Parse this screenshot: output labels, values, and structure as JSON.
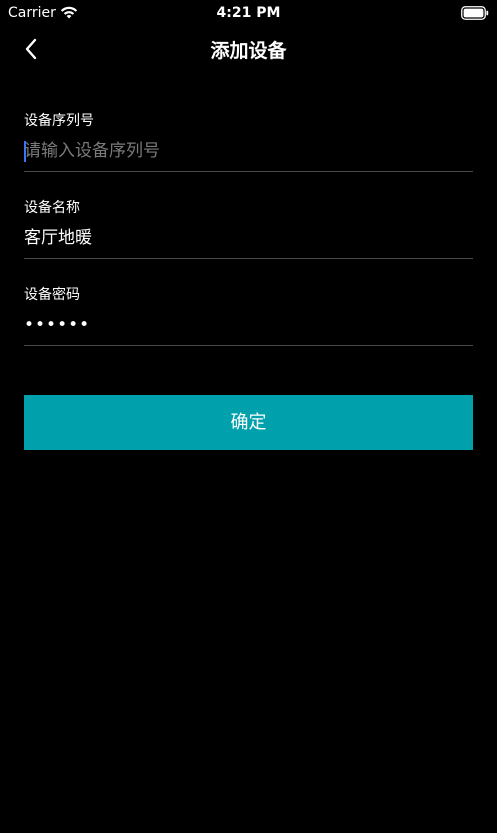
{
  "status_bar": {
    "carrier": "Carrier",
    "time": "4:21 PM",
    "wifi_icon": "wifi-icon",
    "battery_icon": "battery-full-icon"
  },
  "nav": {
    "back_icon": "chevron-left-icon",
    "title": "添加设备"
  },
  "form": {
    "serial": {
      "label": "设备序列号",
      "value": "",
      "placeholder": "请输入设备序列号"
    },
    "name": {
      "label": "设备名称",
      "value": "客厅地暖"
    },
    "password": {
      "label": "设备密码",
      "value": "••••••"
    }
  },
  "confirm_button": {
    "label": "确定"
  },
  "colors": {
    "background": "#000000",
    "accent": "#00a0ac",
    "divider": "#4a4a4a",
    "placeholder": "#7a7a7a",
    "caret": "#3478f6"
  }
}
